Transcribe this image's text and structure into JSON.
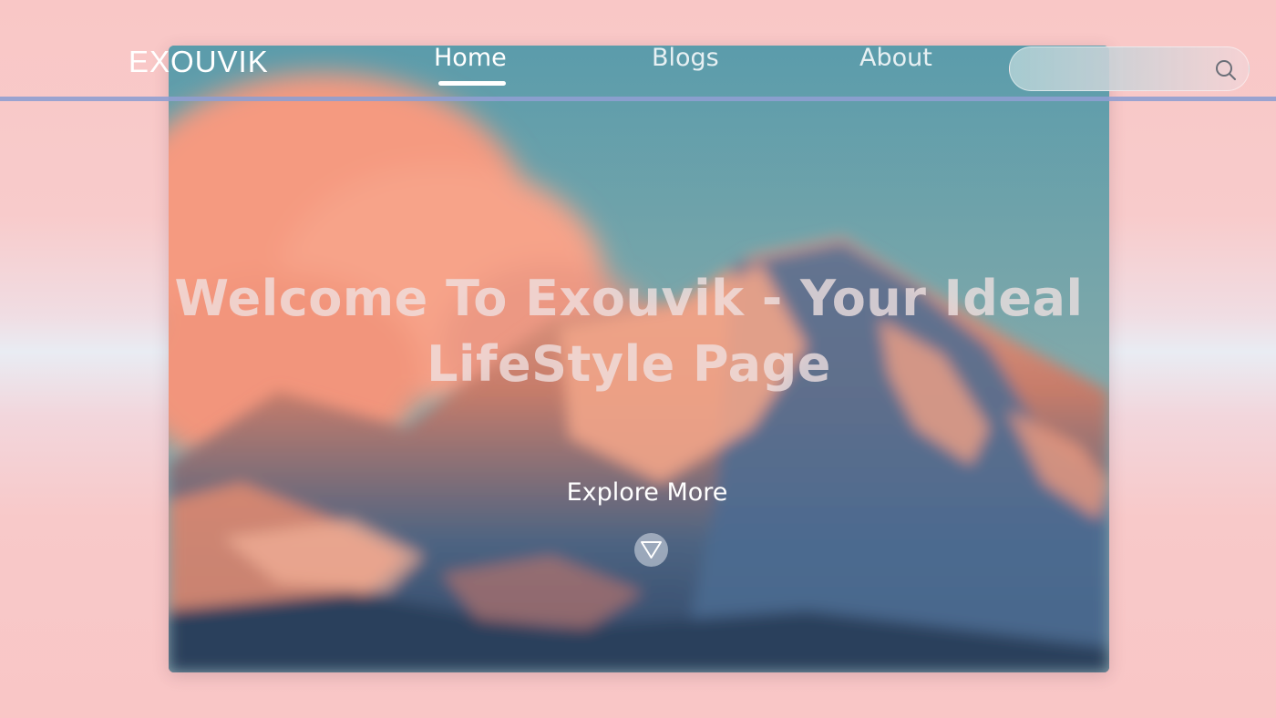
{
  "brand": {
    "logo_text": "EXOUVIK"
  },
  "nav": {
    "items": [
      {
        "label": "Home",
        "active": true
      },
      {
        "label": "Blogs",
        "active": false
      },
      {
        "label": "About",
        "active": false
      }
    ]
  },
  "search": {
    "placeholder": "",
    "value": "",
    "icon": "search-icon"
  },
  "hero": {
    "headline": "Welcome To Exouvik - Your Ideal LifeStyle Page",
    "cta_label": "Explore More",
    "cta_icon": "chevron-down-icon"
  },
  "colors": {
    "page_background": "#f9c7c6",
    "nav_line": "#8f9fd0",
    "text_light": "#ffffff"
  }
}
